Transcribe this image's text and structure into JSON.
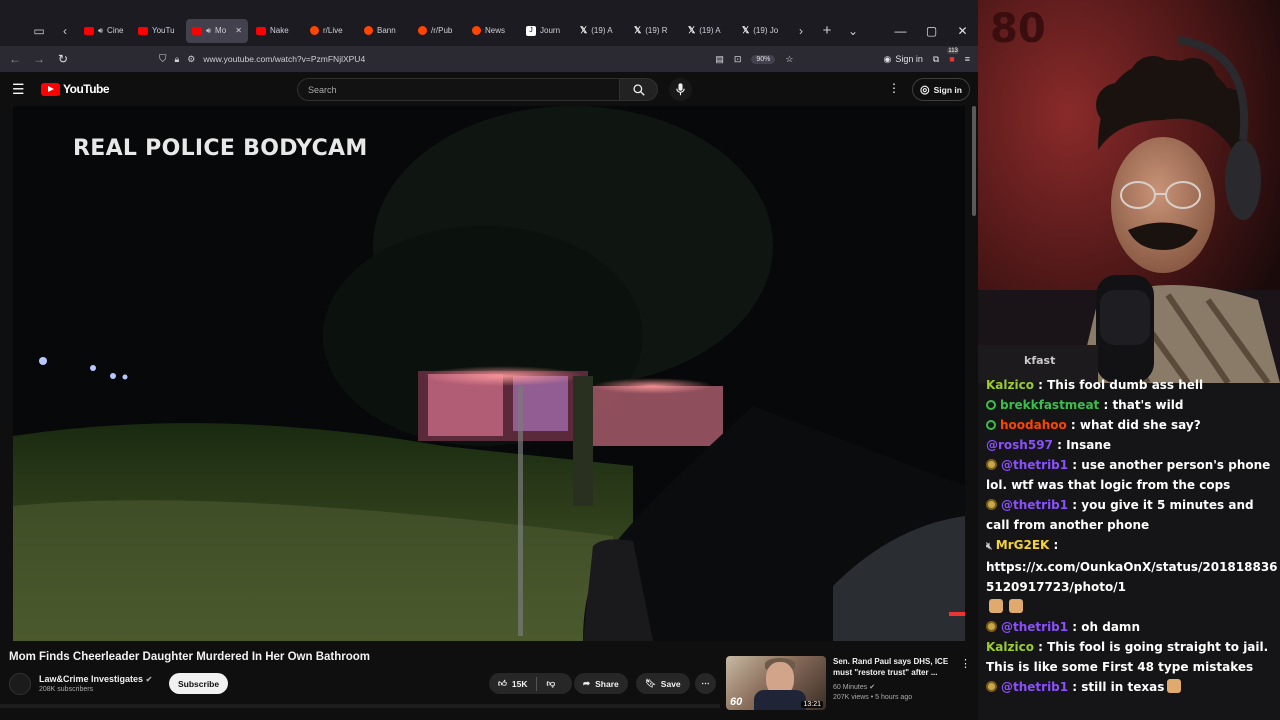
{
  "browser": {
    "tabs": [
      {
        "label": "Cinem",
        "favicon": "youtube",
        "audio": true,
        "active": false
      },
      {
        "label": "YouTu",
        "favicon": "youtube",
        "audio": false,
        "active": false
      },
      {
        "label": "Mo",
        "favicon": "youtube",
        "audio": true,
        "active": true
      },
      {
        "label": "Nake",
        "favicon": "youtube",
        "audio": false,
        "active": false
      },
      {
        "label": "r/Live",
        "favicon": "reddit",
        "audio": false,
        "active": false
      },
      {
        "label": "Bann",
        "favicon": "reddit",
        "audio": false,
        "active": false
      },
      {
        "label": "/r/Pub",
        "favicon": "reddit",
        "audio": false,
        "active": false
      },
      {
        "label": "News",
        "favicon": "reddit",
        "audio": false,
        "active": false
      },
      {
        "label": "Journ",
        "favicon": "journal",
        "audio": false,
        "active": false
      },
      {
        "label": "(19) A",
        "favicon": "x",
        "audio": false,
        "active": false
      },
      {
        "label": "(19) R",
        "favicon": "x",
        "audio": false,
        "active": false
      },
      {
        "label": "(19) A",
        "favicon": "x",
        "audio": false,
        "active": false
      },
      {
        "label": "(19) Jo",
        "favicon": "x",
        "audio": false,
        "active": false
      }
    ],
    "url": "www.youtube.com/watch?v=PzmFNjlXPU4",
    "zoom": "90%",
    "signin_label": "Sign in",
    "extension_badge": "113"
  },
  "youtube": {
    "logo_text": "YouTube",
    "search_placeholder": "Search",
    "signin_label": "Sign in",
    "video_overlay_text": "REAL POLICE BODYCAM",
    "video_title": "Mom Finds Cheerleader Daughter Murdered In Her Own Bathroom",
    "channel_name": "Law&Crime Investigates",
    "channel_subs": "208K subscribers",
    "subscribe_label": "Subscribe",
    "like_count": "15K",
    "share_label": "Share",
    "save_label": "Save",
    "recommended": {
      "title": "Sen. Rand Paul says DHS, ICE must \"restore trust\" after ...",
      "channel": "60 Minutes",
      "meta": "207K views • 5 hours ago",
      "duration": "13:21",
      "thumb_text": "60"
    }
  },
  "stream": {
    "cam_overlay_fragment": "kfast",
    "chat": [
      {
        "user": "Kalzico",
        "color": "#9acd32",
        "badge": "none",
        "message": "This fool dumb ass hell"
      },
      {
        "user": "brekkfastmeat",
        "color": "#3bbf4a",
        "badge": "prime",
        "message": "that's wild"
      },
      {
        "user": "hoodahoo",
        "color": "#ff4500",
        "badge": "prime",
        "message": "what did she say?"
      },
      {
        "user": "@rosh597",
        "color": "#8a4fff",
        "badge": "none",
        "message": "Insane"
      },
      {
        "user": "@thetrib1",
        "color": "#8a4fff",
        "badge": "gold",
        "message": "use another person's phone lol. wtf was that logic from the cops"
      },
      {
        "user": "@thetrib1",
        "color": "#8a4fff",
        "badge": "gold",
        "message": "you give it 5 minutes and call from another phone"
      },
      {
        "user": "MrG2EK",
        "color": "#f3d23b",
        "badge": "mute",
        "message": "https://x.com/OunkaOnX/status/2018188365120917723/photo/1"
      },
      {
        "user": "@thetrib1",
        "color": "#8a4fff",
        "badge": "gold",
        "message": "oh damn"
      },
      {
        "user": "Kalzico",
        "color": "#9acd32",
        "badge": "none",
        "message": "This fool is going straight to jail. This is like some First 48 type mistakes"
      },
      {
        "user": "@thetrib1",
        "color": "#8a4fff",
        "badge": "gold",
        "message": "still in texas"
      }
    ]
  }
}
